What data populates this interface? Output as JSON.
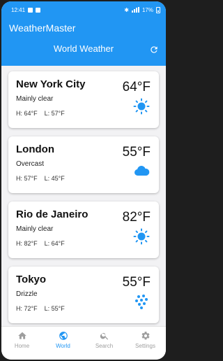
{
  "status_bar": {
    "time": "12:41",
    "battery": "17%"
  },
  "app": {
    "name": "WeatherMaster"
  },
  "header": {
    "title": "World Weather",
    "refresh_icon": "refresh-icon"
  },
  "cities": [
    {
      "name": "New York City",
      "condition": "Mainly clear",
      "high": "H: 64°F",
      "low": "L: 57°F",
      "temp": "64°F",
      "icon": "sun-icon"
    },
    {
      "name": "London",
      "condition": "Overcast",
      "high": "H: 57°F",
      "low": "L: 45°F",
      "temp": "55°F",
      "icon": "cloud-icon"
    },
    {
      "name": "Rio de Janeiro",
      "condition": "Mainly clear",
      "high": "H: 82°F",
      "low": "L: 64°F",
      "temp": "82°F",
      "icon": "sun-icon"
    },
    {
      "name": "Tokyo",
      "condition": "Drizzle",
      "high": "H: 72°F",
      "low": "L: 55°F",
      "temp": "55°F",
      "icon": "drizzle-icon"
    }
  ],
  "nav": [
    {
      "label": "Home",
      "icon": "home-icon"
    },
    {
      "label": "World",
      "icon": "globe-icon",
      "active": true
    },
    {
      "label": "Search",
      "icon": "search-icon"
    },
    {
      "label": "Settings",
      "icon": "gear-icon"
    }
  ],
  "colors": {
    "primary": "#2196f3",
    "icon_blue": "#2196f3",
    "background": "#f2f2f4"
  }
}
